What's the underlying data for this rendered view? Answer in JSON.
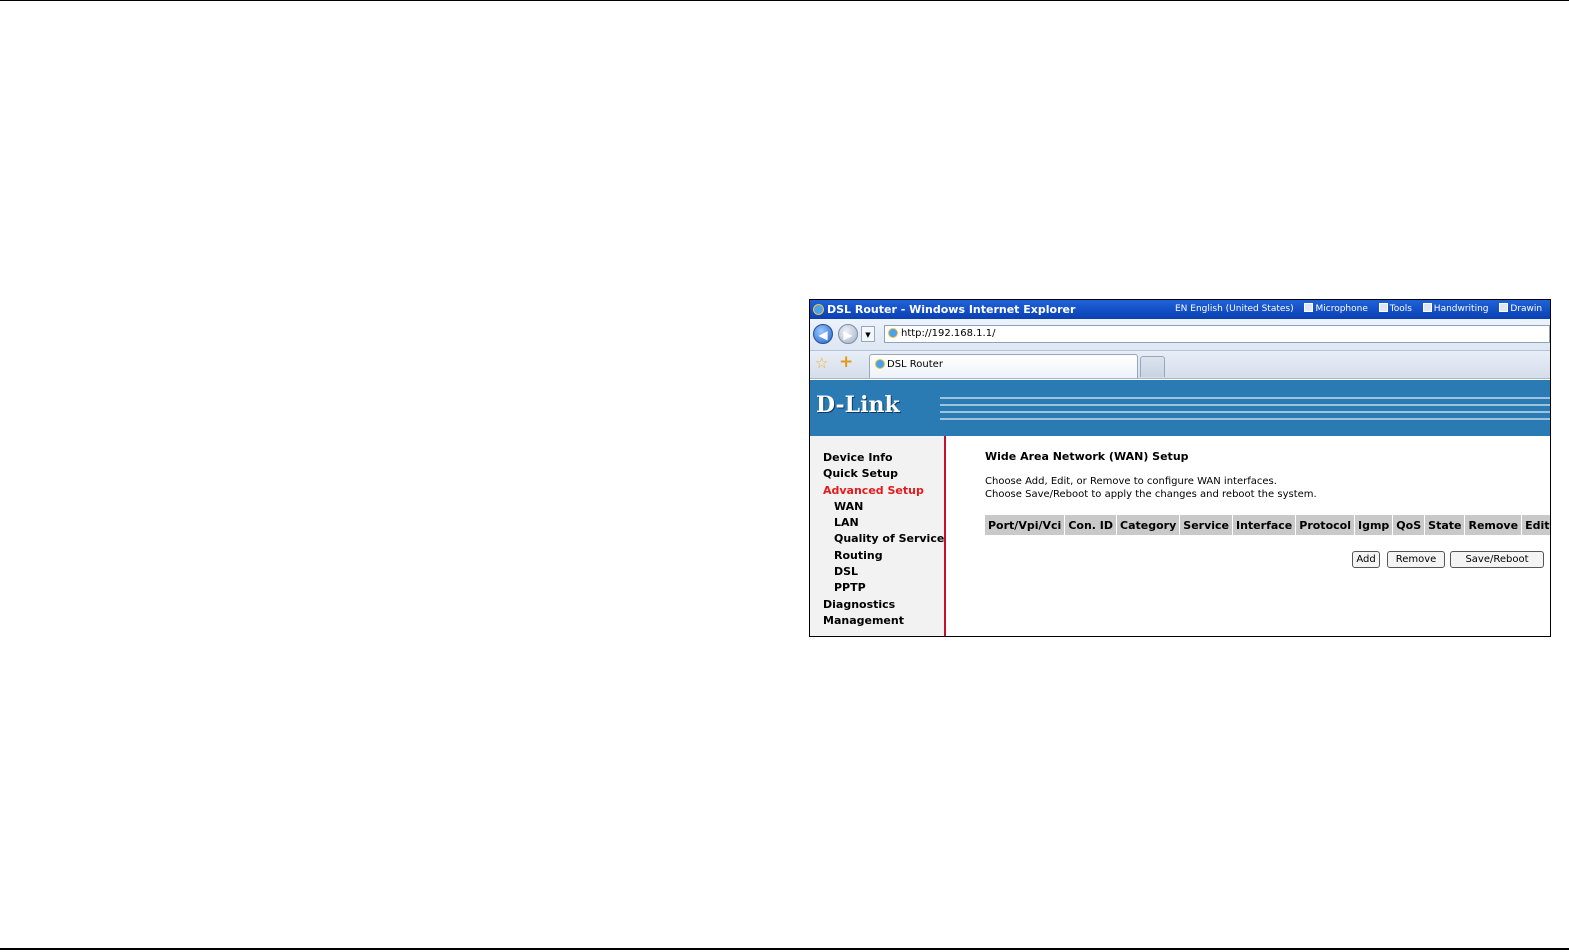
{
  "window": {
    "title": "DSL Router - Windows Internet Explorer",
    "language_bar": [
      "EN English (United States)",
      "Microphone",
      "Tools",
      "Handwriting",
      "Drawin"
    ]
  },
  "address": {
    "url": "http://192.168.1.1/"
  },
  "tabs": [
    {
      "label": "DSL Router"
    }
  ],
  "brand": {
    "logo": "D-Link"
  },
  "sidebar": {
    "items": [
      {
        "label": "Device Info"
      },
      {
        "label": "Quick Setup"
      },
      {
        "label": "Advanced Setup"
      },
      {
        "label": "WAN"
      },
      {
        "label": "LAN"
      },
      {
        "label": "Quality of Service"
      },
      {
        "label": "Routing"
      },
      {
        "label": "DSL"
      },
      {
        "label": "PPTP"
      },
      {
        "label": "Diagnostics"
      },
      {
        "label": "Management"
      }
    ]
  },
  "main": {
    "heading": "Wide Area Network (WAN) Setup",
    "line1": "Choose Add, Edit, or Remove to configure WAN interfaces.",
    "line2": "Choose Save/Reboot to apply the changes and reboot the system.",
    "table_headers": [
      "Port/Vpi/Vci",
      "Con. ID",
      "Category",
      "Service",
      "Interface",
      "Protocol",
      "Igmp",
      "QoS",
      "State",
      "Remove",
      "Edit"
    ],
    "buttons": {
      "add": "Add",
      "remove": "Remove",
      "save_reboot": "Save/Reboot"
    }
  },
  "colors": {
    "banner": "#2a7ab4",
    "active_menu": "#e51a1a",
    "sidebar_border": "#c8102e",
    "table_header": "#c9c9c9"
  }
}
